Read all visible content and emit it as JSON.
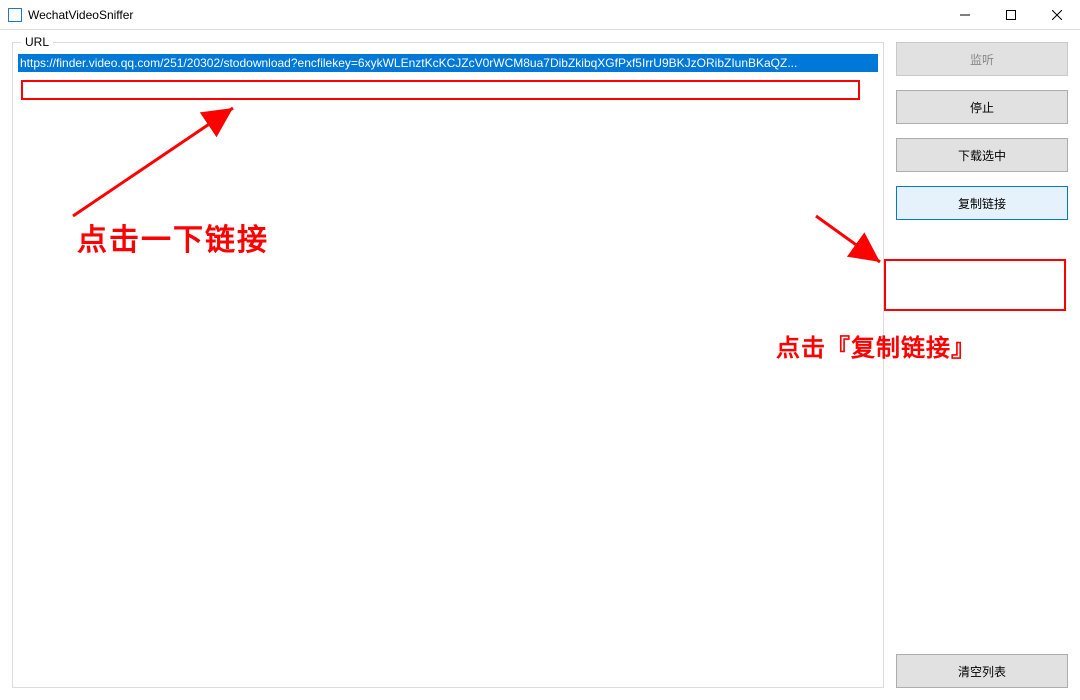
{
  "window": {
    "title": "WechatVideoSniffer"
  },
  "groupbox": {
    "label": "URL"
  },
  "url_item": "https://finder.video.qq.com/251/20302/stodownload?encfilekey=6xykWLEnztKcKCJZcV0rWCM8ua7DibZkibqXGfPxf5IrrU9BKJzORibZIunBKaQZ...",
  "buttons": {
    "listen": "监听",
    "stop": "停止",
    "download_selected": "下载选中",
    "copy_link": "复制链接",
    "clear_list": "清空列表"
  },
  "annotations": {
    "click_link": "点击一下链接",
    "click_copy": "点击『复制链接』"
  }
}
